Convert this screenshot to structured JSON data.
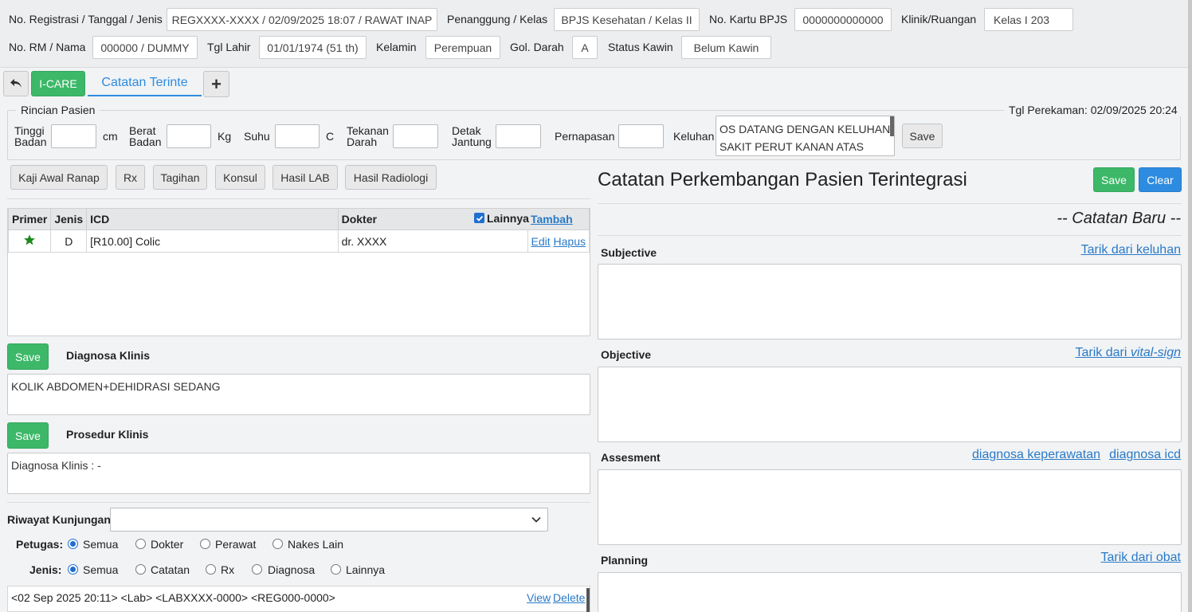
{
  "patient": {
    "reg_label": "No. Registrasi / Tanggal / Jenis",
    "reg_value": "REGXXXX-XXXX / 02/09/2025 18:07 / RAWAT INAP",
    "penanggung_label": "Penanggung / Kelas",
    "penanggung_value": "BPJS Kesehatan / Kelas II",
    "bpjs_label": "No. Kartu BPJS",
    "bpjs_value": "0000000000000",
    "klinik_label": "Klinik/Ruangan",
    "klinik_value": "Kelas I 203",
    "rm_label": "No. RM / Nama",
    "rm_value": "000000 / DUMMY",
    "lahir_label": "Tgl Lahir",
    "lahir_value": "01/01/1974 (51 th)",
    "kelamin_label": "Kelamin",
    "kelamin_value": "Perempuan",
    "darah_label": "Gol. Darah",
    "darah_value": "A",
    "kawin_label": "Status Kawin",
    "kawin_value": "Belum Kawin"
  },
  "tabs": {
    "back_icon": "undo-arrow-icon",
    "icare": "I-CARE",
    "active": "Catatan Terinte",
    "add": "+"
  },
  "rincian": {
    "legend": "Rincian Pasien",
    "tgl_perekaman": "Tgl Perekaman: 02/09/2025 20:24",
    "tinggi_1": "Tinggi",
    "tinggi_2": "Badan",
    "tinggi_unit": "cm",
    "berat_1": "Berat",
    "berat_2": "Badan",
    "berat_unit": "Kg",
    "suhu": "Suhu",
    "suhu_unit": "C",
    "tekanan_1": "Tekanan",
    "tekanan_2": "Darah",
    "detak_1": "Detak",
    "detak_2": "Jantung",
    "pernapasan": "Pernapasan",
    "keluhan": "Keluhan",
    "keluhan_line1": "OS DATANG DENGAN KELUHAN",
    "keluhan_line2": "SAKIT PERUT KANAN ATAS",
    "save": "Save"
  },
  "actions": [
    "Kaji Awal Ranap",
    "Rx",
    "Tagihan",
    "Konsul",
    "Hasil LAB",
    "Hasil Radiologi"
  ],
  "icd_table": {
    "headers": {
      "primer": "Primer",
      "jenis": "Jenis",
      "icd": "ICD",
      "dokter": "Dokter",
      "lainnya": "Lainnya",
      "tambah": "Tambah"
    },
    "rows": [
      {
        "jenis": "D",
        "icd": "[R10.00] Colic",
        "dokter": "dr. XXXX",
        "edit": "Edit",
        "hapus": "Hapus"
      }
    ]
  },
  "diagnosa": {
    "save": "Save",
    "title": "Diagnosa Klinis",
    "value": "KOLIK ABDOMEN+DEHIDRASI SEDANG"
  },
  "prosedur": {
    "save": "Save",
    "title": "Prosedur Klinis",
    "value": "Diagnosa Klinis : -"
  },
  "riwayat": {
    "label": "Riwayat Kunjungan",
    "petugas_label": "Petugas:",
    "petugas_options": [
      "Semua",
      "Dokter",
      "Perawat",
      "Nakes Lain"
    ],
    "jenis_label": "Jenis:",
    "jenis_options": [
      "Semua",
      "Catatan",
      "Rx",
      "Diagnosa",
      "Lainnya"
    ],
    "entry": "<02 Sep 2025 20:11> <Lab> <LABXXXX-0000> <REG000-0000>",
    "view": "View",
    "delete": "Delete"
  },
  "cppt": {
    "title": "Catatan Perkembangan Pasien Terintegrasi",
    "save": "Save",
    "clear": "Clear",
    "subtitle": "-- Catatan Baru --",
    "subjective": "Subjective",
    "subjective_link": "Tarik dari keluhan",
    "objective": "Objective",
    "objective_link_a": "Tarik dari ",
    "objective_link_b": "vital-sign",
    "assesment": "Assesment",
    "assesment_link1": "diagnosa keperawatan",
    "assesment_link2": "diagnosa icd",
    "planning": "Planning",
    "planning_link": "Tarik dari obat"
  },
  "colors": {
    "green": "#3cb868",
    "blue": "#2d8ce0",
    "link": "#2a7ac7",
    "star": "#1e8a1e"
  }
}
